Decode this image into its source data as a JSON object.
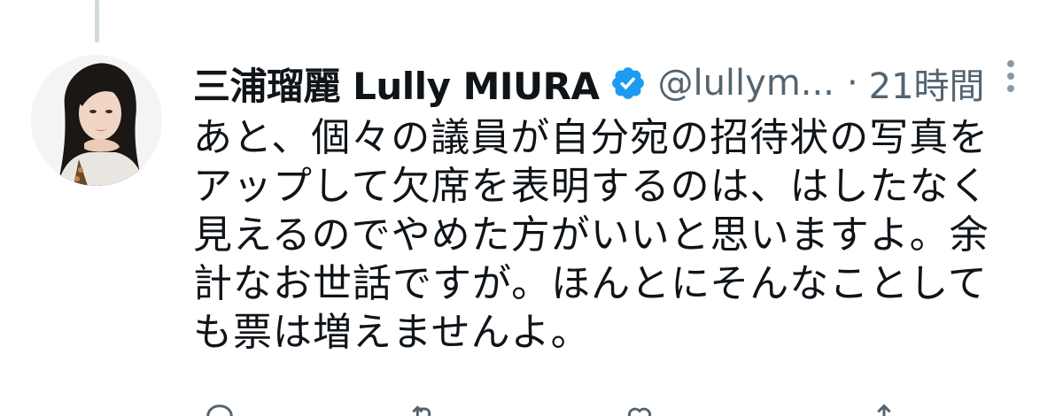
{
  "tweet": {
    "display_name": "三浦瑠麗 Lully MIURA",
    "handle": "@lullym...",
    "separator": "·",
    "timestamp": "21時間",
    "text_lines": [
      "あと、個々の議員が自分宛の招待状の写真を",
      "アップして欠席を表明するのは、はしたなく",
      "見えるのでやめた方がいいと思いますよ。余",
      "計なお世話ですが。ほんとにそんなことして",
      "も票は増えませんよ。"
    ],
    "actions": {
      "reply_count": "",
      "retweet_count": "",
      "like_count": ""
    }
  },
  "icons": {
    "verified": "verified-badge-icon",
    "more": "more-options-icon",
    "reply": "reply-icon",
    "retweet": "retweet-icon",
    "like": "heart-icon",
    "share": "share-icon"
  },
  "colors": {
    "text_primary": "#0f1419",
    "text_secondary": "#536471",
    "verified_blue": "#1d9bf0",
    "thread_line": "#cfd9de"
  }
}
